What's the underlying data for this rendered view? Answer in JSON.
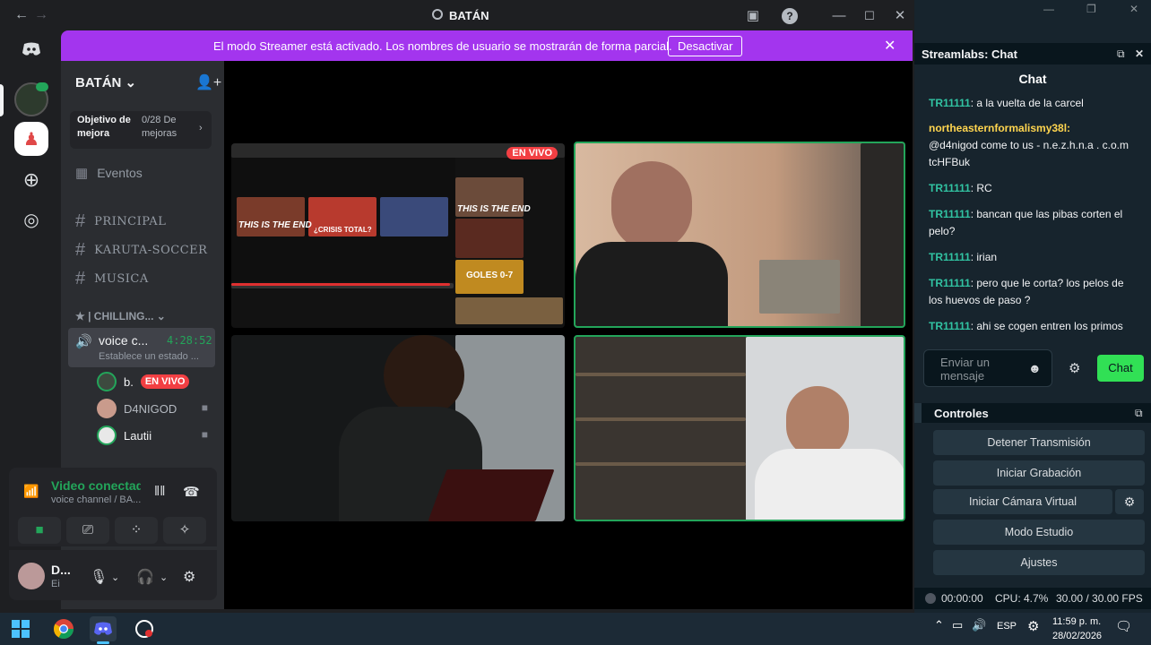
{
  "titlebar": {
    "title": "BATÁN",
    "back": "←",
    "forward": "→"
  },
  "banner": {
    "text": "El modo Streamer está activado. Los nombres de usuario se mostrarán de forma parcial.",
    "button": "Desactivar",
    "close": "✕"
  },
  "sidebar": {
    "server_name": "BATÁN ⌄",
    "goal_title": "Objetivo de mejora",
    "goal_progress": "0/28 De mejoras",
    "events": "Eventos",
    "channels": [
      "PRINCIPAL",
      "KARUTA-SOCCER",
      "MUSICA"
    ],
    "category": "★ | CHILLING... ⌄",
    "voice_channel": {
      "name": "voice c...",
      "time": "4:28:52",
      "status": "Establece un estado ..."
    },
    "members": [
      {
        "name": "b.",
        "badge": "EN VIVO"
      },
      {
        "name": "D4NIGOD"
      },
      {
        "name": "Lautii"
      }
    ]
  },
  "voice": {
    "title": "Video conectad",
    "subtitle": "voice channel / BA..."
  },
  "user": {
    "name": "D...",
    "status": "Ei"
  },
  "stage": {
    "live_badge": "EN VIVO",
    "thumb_texts": [
      "THIS IS THE END",
      "¿CRISIS TOTAL?",
      "THIS IS THE END",
      "GOLES 0-7"
    ]
  },
  "streamlabs": {
    "panel_title": "Streamlabs: Chat",
    "chat_title": "Chat",
    "messages": [
      {
        "user": "TR11111",
        "text": ": a la vuelta de la carcel"
      },
      {
        "user": "northeasternformalismy38l:",
        "text": "@d4nigod come to us - n.e.z.h.n.a . c.o.m tcHFBuk"
      },
      {
        "user": "TR11111",
        "text": ": RC"
      },
      {
        "user": "TR11111",
        "text": ": bancan que las pibas corten el pelo?"
      },
      {
        "user": "TR11111",
        "text": ": irian"
      },
      {
        "user": "TR11111",
        "text": ": pero que le corta? los pelos de los huevos de paso ?"
      },
      {
        "user": "TR11111",
        "text": ": ahi se cogen entren los primos"
      }
    ],
    "input_placeholder": "Enviar un mensaje",
    "send": "Chat",
    "controls_title": "Controles",
    "controls": [
      "Detener Transmisión",
      "Iniciar Grabación",
      "Iniciar Cámara Virtual",
      "Modo Estudio",
      "Ajustes"
    ],
    "status": {
      "time": "00:00:00",
      "cpu": "CPU: 4.7%",
      "fps": "30.00 / 30.00 FPS"
    }
  },
  "taskbar": {
    "lang": "ESP",
    "time": "11:59 p. m.",
    "date": "28/02/2026"
  },
  "colors": {
    "accent_purple": "#a335ee",
    "discord_green": "#23a55a",
    "streamlabs_green": "#31e055",
    "live_red": "#f23f43"
  }
}
